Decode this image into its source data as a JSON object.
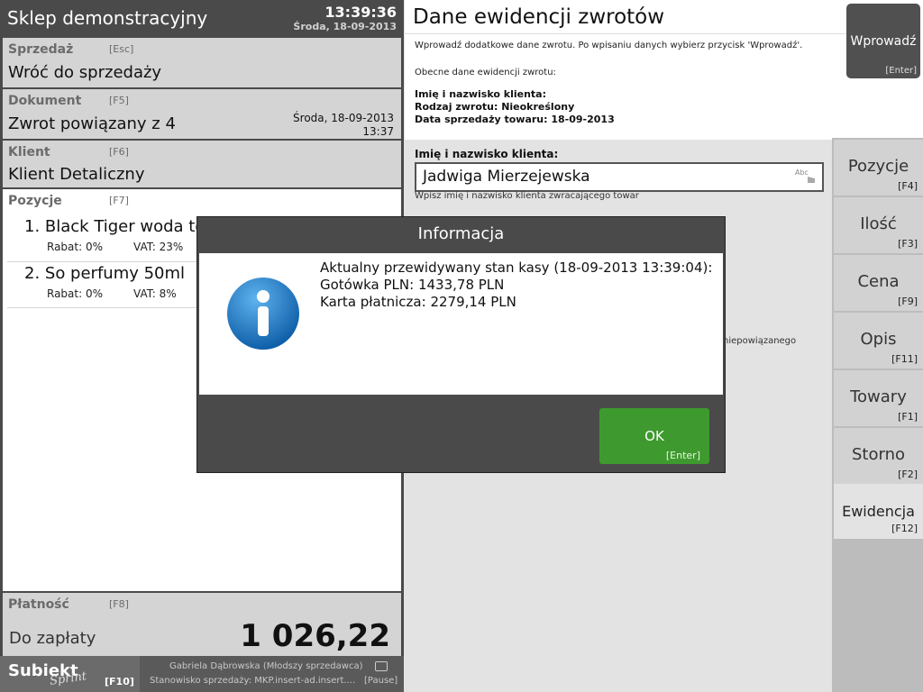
{
  "header": {
    "store_name": "Sklep demonstracyjny",
    "time": "13:39:36",
    "date": "Środa, 18-09-2013"
  },
  "sections": {
    "sale": {
      "label": "Sprzedaż",
      "key": "[Esc]",
      "value": "Wróć do sprzedaży"
    },
    "document": {
      "label": "Dokument",
      "key": "[F5]",
      "value": "Zwrot powiązany z 4",
      "date": "Środa, 18-09-2013",
      "time": "13:37"
    },
    "client": {
      "label": "Klient",
      "key": "[F6]",
      "value": "Klient Detaliczny"
    },
    "positions": {
      "label": "Pozycje",
      "key": "[F7]"
    }
  },
  "items": [
    {
      "name": "1. Black Tiger woda toa",
      "discount": "Rabat: 0%",
      "vat": "VAT: 23%"
    },
    {
      "name": "2. So perfumy 50ml",
      "discount": "Rabat: 0%",
      "vat": "VAT: 8%"
    }
  ],
  "payment": {
    "label": "Płatność",
    "key": "[F8]",
    "due_label": "Do zapłaty",
    "amount": "1 026,22"
  },
  "footer": {
    "brand": "Subiekt",
    "brand_sub": "Sprint",
    "brand_key": "[F10]",
    "user": "Gabriela Dąbrowska (Młodszy sprzedawca)",
    "station": "Stanowisko sprzedaży: MKP.insert-ad.insert....",
    "pause": "[Pause]"
  },
  "panel": {
    "title": "Dane ewidencji zwrotów",
    "instructions": "Wprowadź dodatkowe dane zwrotu. Po wpisaniu danych wybierz przycisk 'Wprowadź'.",
    "current_label": "Obecne dane ewidencji zwrotu:",
    "line1": "Imię i nazwisko klienta:",
    "line2": "Rodzaj zwrotu: Nieokreślony",
    "line3": "Data sprzedaży towaru: 18-09-2013",
    "enter_button": {
      "label": "Wprowadź",
      "key": "[Enter]"
    },
    "field_label": "Imię i nazwisko klienta:",
    "field_value": "Jadwiga Mierzejewska",
    "field_hint": "Wpisz imię i nazwisko klienta zwracającego towar",
    "partial_text": "niepowiązanego"
  },
  "side_buttons": [
    {
      "label": "Pozycje",
      "key": "[F4]"
    },
    {
      "label": "Ilość",
      "key": "[F3]"
    },
    {
      "label": "Cena",
      "key": "[F9]"
    },
    {
      "label": "Opis",
      "key": "[F11]"
    },
    {
      "label": "Towary",
      "key": "[F1]"
    },
    {
      "label": "Storno",
      "key": "[F2]"
    },
    {
      "label": "Ewidencja",
      "key": "[F12]"
    }
  ],
  "modal": {
    "title": "Informacja",
    "line1": "Aktualny przewidywany stan kasy (18-09-2013 13:39:04):",
    "line2": "Gotówka PLN: 1433,78 PLN",
    "line3": "Karta płatnicza: 2279,14 PLN",
    "ok_label": "OK",
    "ok_key": "[Enter]"
  },
  "colors": {
    "ok_green": "#3e9a2e",
    "info_blue": "#1a76c8",
    "dark_gray": "#4a4a4a"
  }
}
